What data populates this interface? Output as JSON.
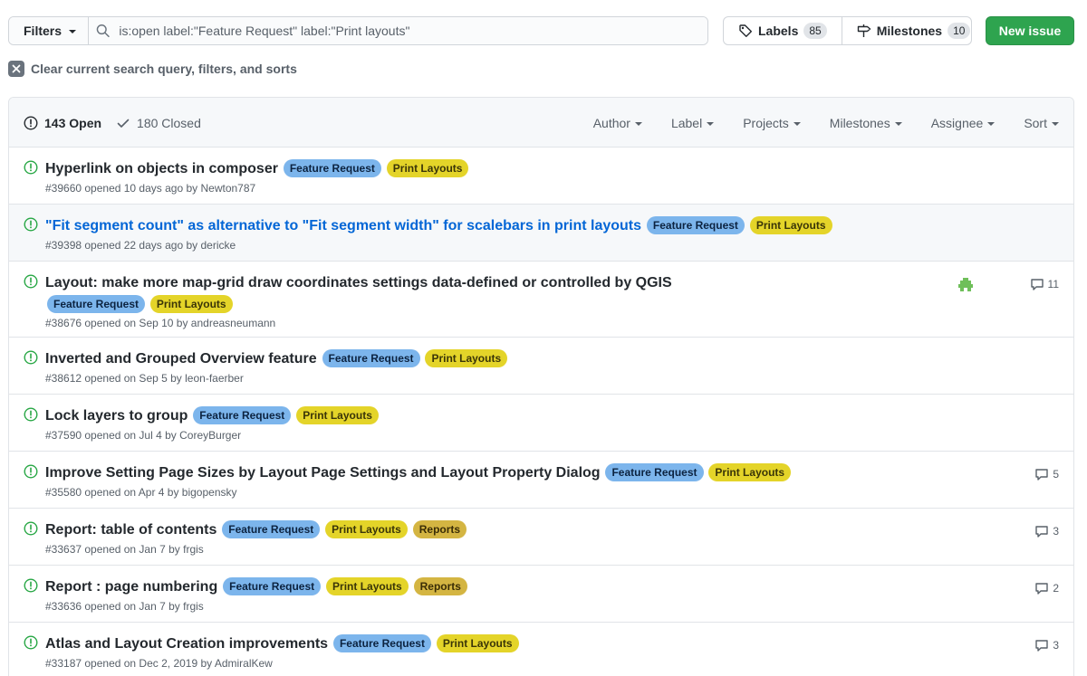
{
  "toolbar": {
    "filters_label": "Filters",
    "search_value": "is:open label:\"Feature Request\" label:\"Print layouts\"",
    "labels_label": "Labels",
    "labels_count": "85",
    "milestones_label": "Milestones",
    "milestones_count": "10",
    "new_issue_label": "New issue"
  },
  "clear_label": "Clear current search query, filters, and sorts",
  "header": {
    "open_label": "143 Open",
    "closed_label": "180 Closed",
    "filters": [
      "Author",
      "Label",
      "Projects",
      "Milestones",
      "Assignee",
      "Sort"
    ]
  },
  "issues": [
    {
      "title": "Hyperlink on objects in composer",
      "labels": [
        "Feature Request",
        "Print Layouts"
      ],
      "meta": "#39660 opened 10 days ago by Newton787",
      "comments": ""
    },
    {
      "title": "\"Fit segment count\" as alternative to \"Fit segment width\" for scalebars in print layouts",
      "labels": [
        "Feature Request",
        "Print Layouts"
      ],
      "meta": "#39398 opened 22 days ago by dericke",
      "comments": ""
    },
    {
      "title": "Layout: make more map-grid draw coordinates settings data-defined or controlled by QGIS",
      "labels": [
        "Feature Request",
        "Print Layouts"
      ],
      "meta": "#38676 opened on Sep 10 by andreasneumann",
      "comments": "11"
    },
    {
      "title": "Inverted and Grouped Overview feature",
      "labels": [
        "Feature Request",
        "Print Layouts"
      ],
      "meta": "#38612 opened on Sep 5 by leon-faerber",
      "comments": ""
    },
    {
      "title": "Lock layers to group",
      "labels": [
        "Feature Request",
        "Print Layouts"
      ],
      "meta": "#37590 opened on Jul 4 by CoreyBurger",
      "comments": ""
    },
    {
      "title": "Improve Setting Page Sizes by Layout Page Settings and Layout Property Dialog",
      "labels": [
        "Feature Request",
        "Print Layouts"
      ],
      "meta": "#35580 opened on Apr 4 by bigopensky",
      "comments": "5"
    },
    {
      "title": "Report: table of contents",
      "labels": [
        "Feature Request",
        "Print Layouts",
        "Reports"
      ],
      "meta": "#33637 opened on Jan 7 by frgis",
      "comments": "3"
    },
    {
      "title": "Report : page numbering",
      "labels": [
        "Feature Request",
        "Print Layouts",
        "Reports"
      ],
      "meta": "#33636 opened on Jan 7 by frgis",
      "comments": "2"
    },
    {
      "title": "Atlas and Layout Creation improvements",
      "labels": [
        "Feature Request",
        "Print Layouts"
      ],
      "meta": "#33187 opened on Dec 2, 2019 by AdmiralKew",
      "comments": "3"
    }
  ],
  "colors": {
    "feature_request": "#7cb5ec",
    "print_layouts": "#e4d429",
    "reports": "#d4b542",
    "open_green": "#28a745",
    "new_issue_green": "#2ea44f",
    "link_blue": "#0366d6"
  },
  "icons": {
    "search": "search-icon",
    "labels": "tag-icon",
    "milestones": "milestone-icon",
    "open": "issue-opened-icon",
    "closed": "check-icon",
    "comments": "comment-icon",
    "clear": "close-icon"
  }
}
